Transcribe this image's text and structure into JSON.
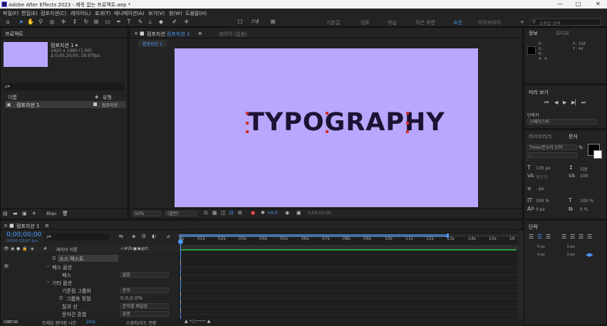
{
  "window": {
    "title": "Adobe After Effects 2023 - 제목 없는 프로젝트.aep *",
    "minimize": "—",
    "maximize": "□",
    "close": "✕"
  },
  "menu": [
    "파일(F)",
    "편집(E)",
    "컴포지션(C)",
    "레이어(L)",
    "효과(T)",
    "애니메이션(A)",
    "보기(V)",
    "창(W)",
    "도움말(H)"
  ],
  "workspaces": [
    "기본값",
    "검토",
    "학습",
    "작은 화면",
    "표준",
    "라이브러리"
  ],
  "workspace_active": "표준",
  "search_help": {
    "placeholder": "도움말 검색"
  },
  "project": {
    "tab": "프로젝트",
    "comp_name": "컴포지션 1 ▾",
    "resolution": "1920 x 1080 (1.00)",
    "duration": "Δ 0;00;20;00, 29.97fps",
    "search_placeholder": "⍴▾",
    "col_name": "이름",
    "col_type": "유형",
    "item_name": "컴포지션 1",
    "item_type": "컴포지션",
    "bpc": "8bpc"
  },
  "comp": {
    "tab": "컴포지션",
    "tab_comp": "컴포지션 1",
    "layer_tab": "레이어 (없음)",
    "breadcrumb": "컴포지션 1",
    "canvas_text": "TYPOGRAPHY",
    "canvas_color": "#b9a7ff",
    "zoom": "50%",
    "quality": "(절반)",
    "exposure": "+0.0",
    "timecode": "0;00;00;00"
  },
  "info": {
    "tab": "정보",
    "audio_tab": "오디오",
    "r": "R :",
    "g": "G :",
    "b": "B :",
    "a": "A : 0",
    "x": "X : 316",
    "y": "Y : 44"
  },
  "preview": {
    "tab": "미리 보기",
    "shortcut_label": "단축키",
    "shortcut_value": "스페이스바"
  },
  "character": {
    "lib_tab": "라이브러리",
    "char_tab": "문자",
    "font": "Tmon몬소리 OTF",
    "font_style": "-",
    "size": "130 px",
    "leading": "자동",
    "kerning": "메트릭",
    "tracking": "100",
    "stroke": "- px",
    "vscale": "100 %",
    "hscale": "100 %",
    "baseline": "0 px",
    "tsume": "0 %"
  },
  "paragraph": {
    "tab": "단락",
    "indent1": "0 px",
    "indent2": "0 px",
    "indent3": "0 px",
    "space1": "0 px",
    "space2": "0 px"
  },
  "timeline": {
    "tab": "컴포지션 1",
    "timecode": "0;00;00;00",
    "fps": "00000 (29.97 fps)",
    "search_placeholder": "⍴▾",
    "col_layer": "레이어 이름",
    "rows": [
      {
        "label": "소스 텍스트",
        "value": ""
      },
      {
        "label": "패스 옵션",
        "value": ""
      },
      {
        "label": "패스",
        "value": "없음"
      },
      {
        "label": "기타 옵션",
        "value": ""
      },
      {
        "label": "기준점 그룹화",
        "value": "문자"
      },
      {
        "label": "그룹화 정렬",
        "value": "0.0,0.0%"
      },
      {
        "label": "칠과 선",
        "value": "문자별 패널당"
      },
      {
        "label": "문자간 혼합",
        "value": "표준"
      }
    ],
    "ruler": [
      "0s",
      "01s",
      "02s",
      "03s",
      "04s",
      "05s",
      "06s",
      "07s",
      "08s",
      "09s",
      "10s",
      "11s",
      "12s",
      "13s",
      "14s",
      "15s",
      "16"
    ],
    "footer": "프레임 렌더링 시간",
    "footer_value": "2ms",
    "switch": "스위치/모드 전환"
  }
}
